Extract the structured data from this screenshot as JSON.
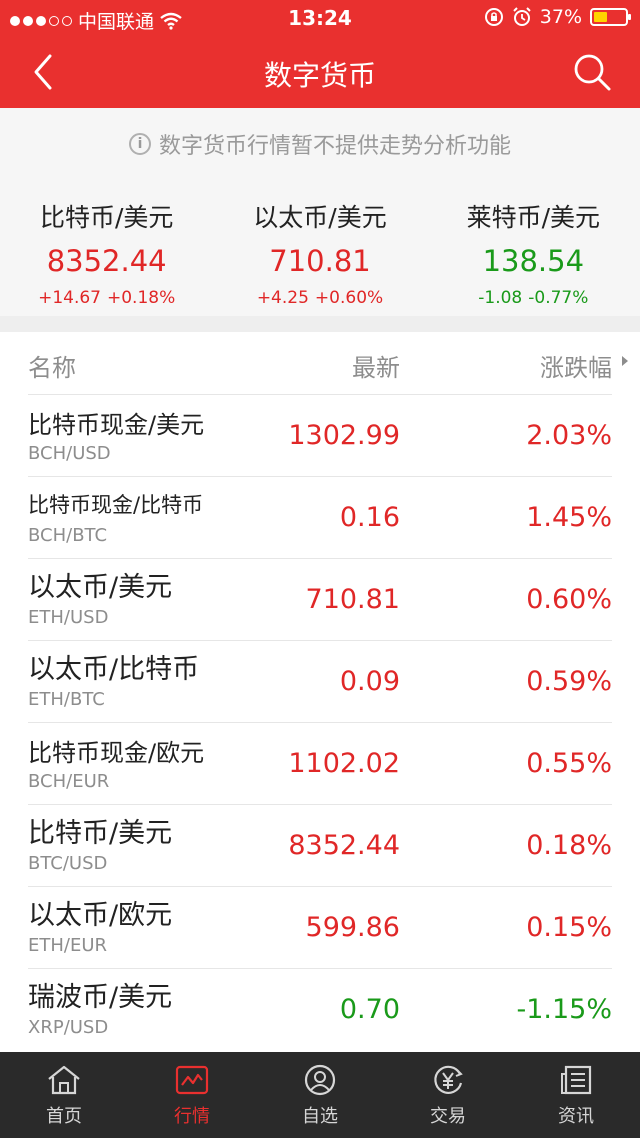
{
  "status": {
    "carrier": "中国联通",
    "time": "13:24",
    "battery": "37%"
  },
  "header": {
    "title": "数字货币"
  },
  "notice": "数字货币行情暂不提供走势分析功能",
  "summary": [
    {
      "name": "比特币/美元",
      "price": "8352.44",
      "change": "+14.67",
      "percent": "+0.18%"
    },
    {
      "name": "以太币/美元",
      "price": "710.81",
      "change": "+4.25",
      "percent": "+0.60%"
    },
    {
      "name": "莱特币/美元",
      "price": "138.54",
      "change": "-1.08",
      "percent": "-0.77%"
    }
  ],
  "table": {
    "headers": {
      "name": "名称",
      "last": "最新",
      "change": "涨跌幅"
    },
    "rows": [
      {
        "name": "比特币现金/美元",
        "code": "BCH/USD",
        "last": "1302.99",
        "pct": "2.03%"
      },
      {
        "name": "比特币现金/比特币",
        "code": "BCH/BTC",
        "last": "0.16",
        "pct": "1.45%"
      },
      {
        "name": "以太币/美元",
        "code": "ETH/USD",
        "last": "710.81",
        "pct": "0.60%"
      },
      {
        "name": "以太币/比特币",
        "code": "ETH/BTC",
        "last": "0.09",
        "pct": "0.59%"
      },
      {
        "name": "比特币现金/欧元",
        "code": "BCH/EUR",
        "last": "1102.02",
        "pct": "0.55%"
      },
      {
        "name": "比特币/美元",
        "code": "BTC/USD",
        "last": "8352.44",
        "pct": "0.18%"
      },
      {
        "name": "以太币/欧元",
        "code": "ETH/EUR",
        "last": "599.86",
        "pct": "0.15%"
      },
      {
        "name": "瑞波币/美元",
        "code": "XRP/USD",
        "last": "0.70",
        "pct": "-1.15%"
      }
    ]
  },
  "tabs": [
    {
      "label": "首页",
      "icon": "home-icon"
    },
    {
      "label": "行情",
      "icon": "chart-icon"
    },
    {
      "label": "自选",
      "icon": "person-icon"
    },
    {
      "label": "交易",
      "icon": "yen-icon"
    },
    {
      "label": "资讯",
      "icon": "news-icon"
    }
  ],
  "colors": {
    "brand": "#e9302f",
    "up": "#e02727",
    "down": "#1a9a1a",
    "tabbar": "#2a2a2a"
  }
}
